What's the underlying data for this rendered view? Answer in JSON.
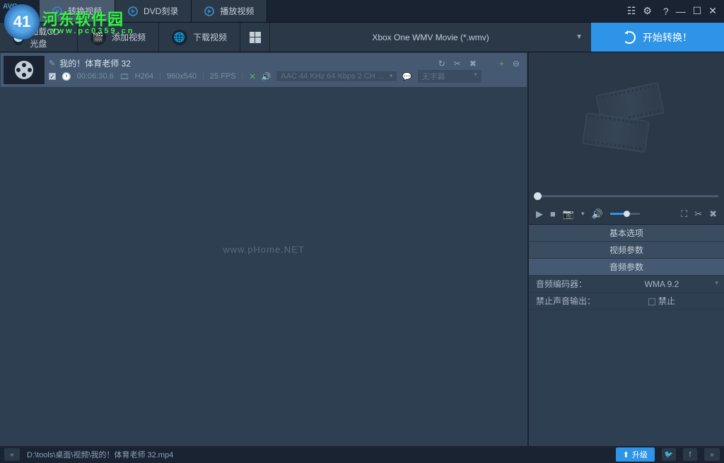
{
  "overlay": {
    "badge_text": "41",
    "watermark_main": "河东软件园",
    "watermark_sub": "www.pc0359.cn"
  },
  "tabs": {
    "convert": "转换视频",
    "dvd": "DVD刻录",
    "play": "播放视频"
  },
  "window_controls": {
    "list": "☷",
    "settings": "⚙",
    "help": "?",
    "minimize": "—",
    "maximize": "☐",
    "close": "✕"
  },
  "toolbar": {
    "load_cd": "加载CD光盘",
    "add_video": "添加视频",
    "download_video": "下载视频",
    "format": "Xbox One WMV Movie (*.wmv)",
    "start_convert": "开始转换！"
  },
  "file": {
    "name": "我的！体育老师 32",
    "duration": "00:06:30.6",
    "codec": "H264",
    "resolution": "960x540",
    "fps": "25 FPS",
    "audio": "AAC 44 KHz 64 Kbps 2 CH ...",
    "subtitle": "无字幕",
    "checkbox": "✓"
  },
  "actions": {
    "refresh": "↻",
    "cut": "✂",
    "adjust": "✖",
    "add": "+",
    "remove": "⊖"
  },
  "center_watermark": "www.pHome.NET",
  "player": {
    "play": "▶",
    "stop": "■",
    "snapshot": "📷",
    "volume": "🔊",
    "fullscreen": "⛶",
    "cut": "✂",
    "adjust": "✖",
    "caret": "▾"
  },
  "accordion": {
    "basic": "基本选项",
    "video": "视频参数",
    "audio": "音频参数"
  },
  "audio_params": {
    "encoder_label": "音频编码器：",
    "encoder_value": "WMA 9.2",
    "mute_label": "禁止声音输出：",
    "mute_value": "禁止"
  },
  "status": {
    "path": "D:\\tools\\桌面\\视频\\我的！体育老师 32.mp4",
    "upgrade": "升级",
    "collapse": "«",
    "expand": "»",
    "twitter": "🐦",
    "facebook": "f",
    "upgrade_arrow": "⬆"
  }
}
